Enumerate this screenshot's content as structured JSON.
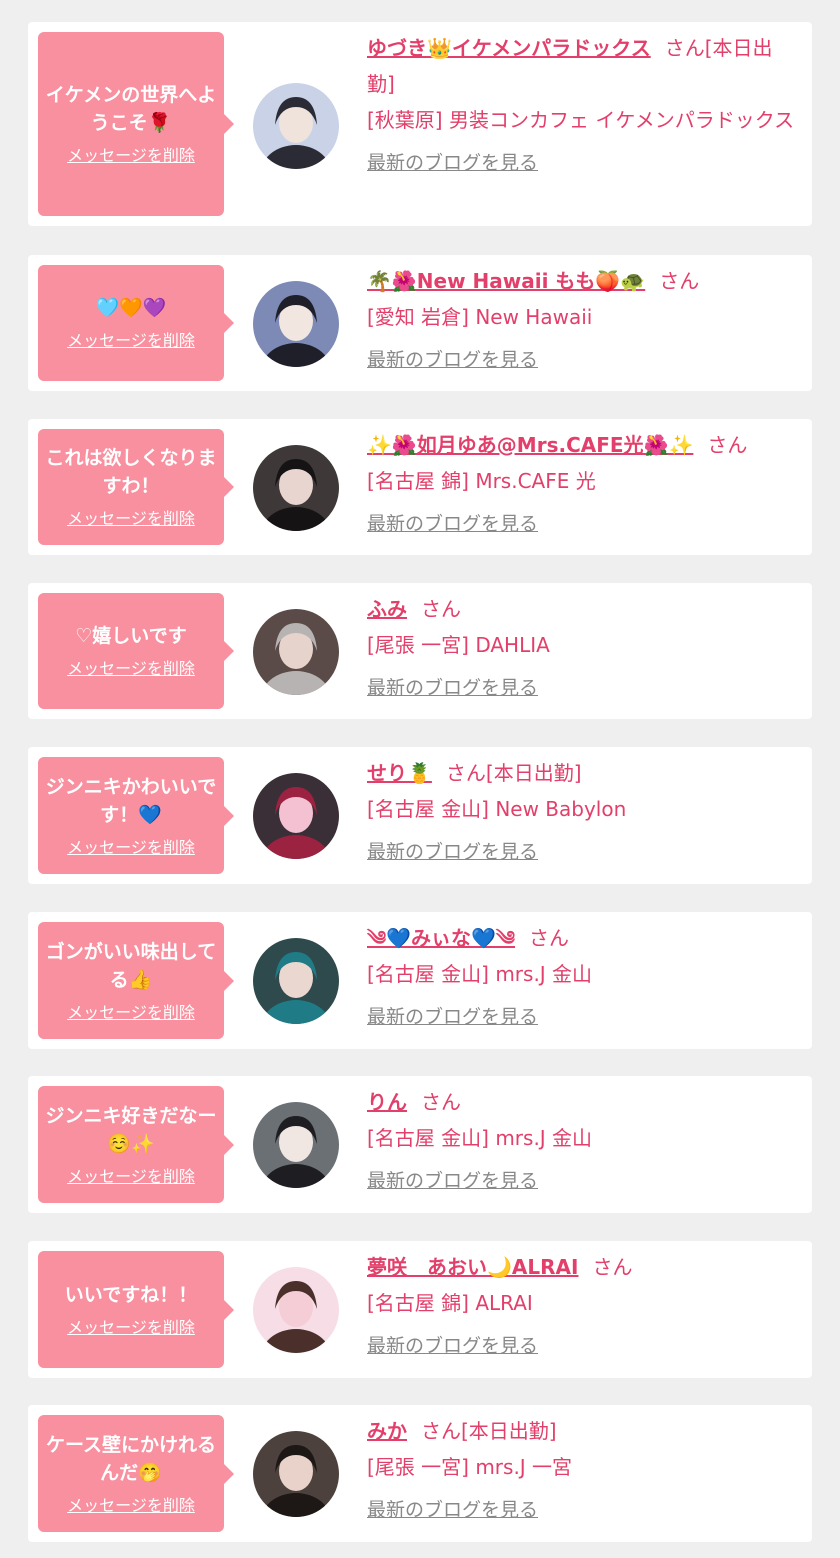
{
  "colors": {
    "accent": "#e23f6a",
    "bubble": "#f8909f",
    "page_background": "#efefef",
    "card_background": "#ffffff",
    "blog_link": "#888888"
  },
  "delete_label": "メッセージを削除",
  "blog_label": "最新のブログを見る",
  "san_label": "さん",
  "items": [
    {
      "message": "イケメンの世界へようこそ🌹",
      "name": "ゆづき👑イケメンパラドックス",
      "status": "[本日出勤]",
      "shop": "[秋葉原] 男装コンカフェ イケメンパラドックス",
      "avatar_icon": "avatar-photo"
    },
    {
      "message": "🩵🧡💜",
      "name": "🌴🌺New Hawaii もも🍑🐢",
      "status": "",
      "shop": "[愛知 岩倉] New Hawaii",
      "avatar_icon": "avatar-photo"
    },
    {
      "message": "これは欲しくなりますわ！",
      "name": "✨🌺如月ゆあ@Mrs.CAFE光🌺✨",
      "status": "",
      "shop": "[名古屋 錦] Mrs.CAFE 光",
      "avatar_icon": "avatar-photo"
    },
    {
      "message": "♡嬉しいです",
      "name": "ふみ",
      "status": "",
      "shop": "[尾張 一宮] DAHLIA",
      "avatar_icon": "avatar-photo"
    },
    {
      "message": "ジンニキかわいいです！💙",
      "name": "せり🍍",
      "status": "[本日出勤]",
      "shop": "[名古屋 金山] New Babylon",
      "avatar_icon": "avatar-photo"
    },
    {
      "message": "ゴンがいい味出してる👍",
      "name": "༄💙みぃな💙༄",
      "status": "",
      "shop": "[名古屋 金山] mrs.J 金山",
      "avatar_icon": "avatar-photo"
    },
    {
      "message": "ジンニキ好きだなー☺️✨",
      "name": "りん",
      "status": "",
      "shop": "[名古屋 金山] mrs.J 金山",
      "avatar_icon": "avatar-photo"
    },
    {
      "message": "いいですね！！",
      "name": "夢咲　あおい🌙ALRAI",
      "status": "",
      "shop": "[名古屋 錦] ALRAI",
      "avatar_icon": "avatar-photo"
    },
    {
      "message": "ケース壁にかけれるんだ🤭",
      "name": "みか",
      "status": "[本日出勤]",
      "shop": "[尾張 一宮] mrs.J 一宮",
      "avatar_icon": "avatar-photo"
    }
  ]
}
